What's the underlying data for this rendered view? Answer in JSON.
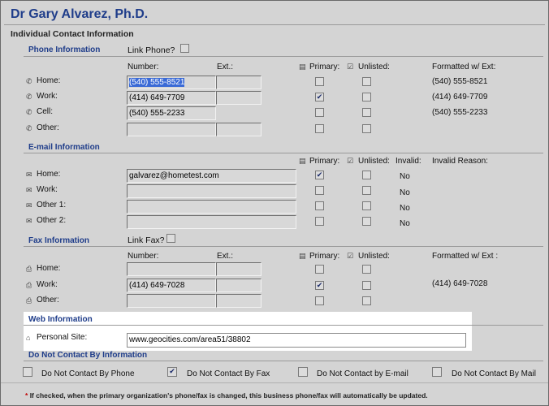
{
  "header": {
    "title": "Dr Gary Alvarez, Ph.D.",
    "subtitle": "Individual Contact Information"
  },
  "phone": {
    "section_title": "Phone Information",
    "link_label": "Link Phone?",
    "col_number": "Number:",
    "col_ext": "Ext.:",
    "col_primary": "Primary:",
    "col_unlisted": "Unlisted:",
    "col_formatted": "Formatted w/ Ext:",
    "rows": [
      {
        "label": "Home:",
        "number": "(540) 555-8521",
        "ext": "",
        "primary": false,
        "unlisted": false,
        "formatted": "(540) 555-8521"
      },
      {
        "label": "Work:",
        "number": "(414) 649-7709",
        "ext": "",
        "primary": true,
        "unlisted": false,
        "formatted": "(414) 649-7709"
      },
      {
        "label": "Cell:",
        "number": "(540) 555-2233",
        "ext": "",
        "primary": false,
        "unlisted": false,
        "formatted": "(540) 555-2233"
      },
      {
        "label": "Other:",
        "number": "",
        "ext": "",
        "primary": false,
        "unlisted": false,
        "formatted": ""
      }
    ]
  },
  "email": {
    "section_title": "E-mail Information",
    "col_primary": "Primary:",
    "col_unlisted": "Unlisted:",
    "col_invalid": "Invalid:",
    "col_reason": "Invalid Reason:",
    "rows": [
      {
        "label": "Home:",
        "value": "galvarez@hometest.com",
        "primary": true,
        "unlisted": false,
        "invalid": "No"
      },
      {
        "label": "Work:",
        "value": "",
        "primary": false,
        "unlisted": false,
        "invalid": "No"
      },
      {
        "label": "Other 1:",
        "value": "",
        "primary": false,
        "unlisted": false,
        "invalid": "No"
      },
      {
        "label": "Other 2:",
        "value": "",
        "primary": false,
        "unlisted": false,
        "invalid": "No"
      }
    ]
  },
  "fax": {
    "section_title": "Fax Information",
    "link_label": "Link Fax?",
    "col_number": "Number:",
    "col_ext": "Ext.:",
    "col_primary": "Primary:",
    "col_unlisted": "Unlisted:",
    "col_formatted": "Formatted w/ Ext :",
    "rows": [
      {
        "label": "Home:",
        "number": "",
        "ext": "",
        "primary": false,
        "unlisted": false,
        "formatted": ""
      },
      {
        "label": "Work:",
        "number": "(414) 649-7028",
        "ext": "",
        "primary": true,
        "unlisted": false,
        "formatted": "(414) 649-7028"
      },
      {
        "label": "Other:",
        "number": "",
        "ext": "",
        "primary": false,
        "unlisted": false,
        "formatted": ""
      }
    ]
  },
  "web": {
    "section_title": "Web Information",
    "label": "Personal Site:",
    "value": "www.geocities.com/area51/38802"
  },
  "dnc": {
    "section_title": "Do Not Contact By Information",
    "items": [
      {
        "label": "Do Not Contact By Phone",
        "checked": false
      },
      {
        "label": "Do Not Contact By Fax",
        "checked": true
      },
      {
        "label": "Do Not Contact by E-mail",
        "checked": false
      },
      {
        "label": "Do Not Contact By Mail",
        "checked": false
      }
    ]
  },
  "footnote": {
    "star": "*",
    "text": "If checked, when the primary organization's phone/fax is changed, this business phone/fax will automatically be updated."
  },
  "icons": {
    "phone": "phone-icon",
    "email": "envelope-icon",
    "fax": "fax-icon",
    "web": "home-icon",
    "primary": "primary-card-icon",
    "unlisted": "unlisted-icon"
  }
}
